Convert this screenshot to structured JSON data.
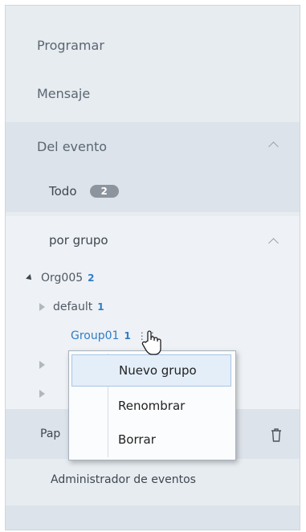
{
  "nav": [
    {
      "label": "Programar"
    },
    {
      "label": "Mensaje"
    }
  ],
  "event_section": {
    "title": "Del evento",
    "todo_label": "Todo",
    "todo_count": "2"
  },
  "group_section": {
    "title": "por grupo",
    "org": {
      "name": "Org005",
      "count": "2"
    },
    "items": [
      {
        "name": "default",
        "count": "1"
      },
      {
        "name": "Group01",
        "count": "1"
      }
    ]
  },
  "partial_item": {
    "label": "Pap"
  },
  "admin": {
    "label": "Administrador de eventos"
  },
  "context_menu": {
    "items": [
      {
        "label": "Nuevo grupo"
      },
      {
        "label": "Renombrar"
      },
      {
        "label": "Borrar"
      }
    ]
  },
  "icons": {
    "collapse": "chevron-up-icon",
    "trash": "trash-icon",
    "cursor": "hand-pointer-icon",
    "more": "more-dots-icon"
  }
}
